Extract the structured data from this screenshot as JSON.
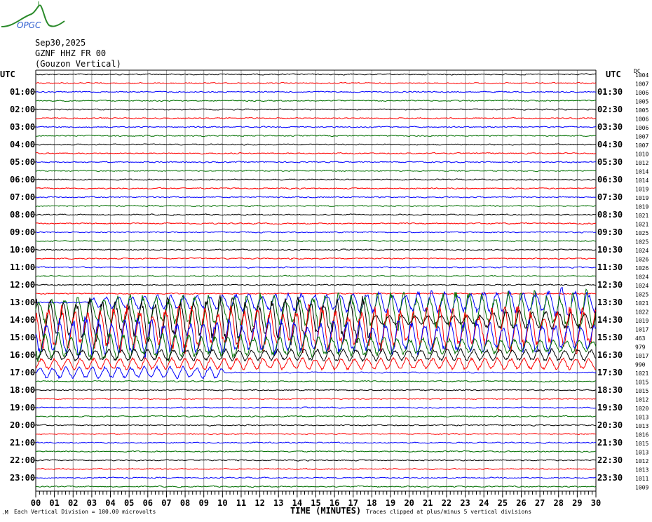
{
  "header": {
    "logo_text": "OPGC",
    "date": "Sep30,2025",
    "station": "GZNF HHZ FR 00",
    "location": "(Gouzon Vertical)",
    "dc_label": "DC"
  },
  "chart_data": {
    "type": "line",
    "title": "GZNF HHZ FR 00 (Gouzon Vertical) Sep30,2025",
    "xlabel": "TIME (MINUTES)",
    "xlim": [
      0,
      30
    ],
    "x_ticks": [
      "00",
      "01",
      "02",
      "03",
      "04",
      "05",
      "06",
      "07",
      "08",
      "09",
      "10",
      "11",
      "12",
      "13",
      "14",
      "15",
      "16",
      "17",
      "18",
      "19",
      "20",
      "21",
      "22",
      "23",
      "24",
      "25",
      "26",
      "27",
      "28",
      "29",
      "30"
    ],
    "left_axis_title": "UTC",
    "right_axis_title": "UTC",
    "left_labels": [
      "01:00",
      "02:00",
      "03:00",
      "04:00",
      "05:00",
      "06:00",
      "07:00",
      "08:00",
      "09:00",
      "10:00",
      "11:00",
      "12:00",
      "13:00",
      "14:00",
      "15:00",
      "16:00",
      "17:00",
      "18:00",
      "19:00",
      "20:00",
      "21:00",
      "22:00",
      "23:00"
    ],
    "right_labels": [
      "01:30",
      "02:30",
      "03:30",
      "04:30",
      "05:30",
      "06:30",
      "07:30",
      "08:30",
      "09:30",
      "10:30",
      "11:30",
      "12:30",
      "13:30",
      "14:30",
      "15:30",
      "16:30",
      "17:30",
      "18:30",
      "19:30",
      "20:30",
      "21:30",
      "22:30",
      "23:30"
    ],
    "trace_colors": [
      "#000000",
      "#ff0000",
      "#0000ff",
      "#007000"
    ],
    "dc_offsets": [
      1004,
      1007,
      1006,
      1005,
      1005,
      1006,
      1006,
      1007,
      1007,
      1010,
      1012,
      1014,
      1014,
      1019,
      1019,
      1019,
      1021,
      1021,
      1025,
      1025,
      1024,
      1026,
      1026,
      1024,
      1024,
      1025,
      1021,
      1022,
      1019,
      1017,
      463,
      979,
      1017,
      990,
      1021,
      1015,
      1015,
      1012,
      1020,
      1013,
      1013,
      1016,
      1015,
      1013,
      1012,
      1013,
      1011,
      1009
    ],
    "rows_per_day": 48,
    "minutes_per_row": 30,
    "event_windows_utc_minutes": [
      [
        783,
        1030
      ]
    ],
    "vertical_division_note": "Each Vertical Division =  100.00 microvolts",
    "clip_note": "Traces clipped at plus/minus 5 vertical divisions"
  }
}
